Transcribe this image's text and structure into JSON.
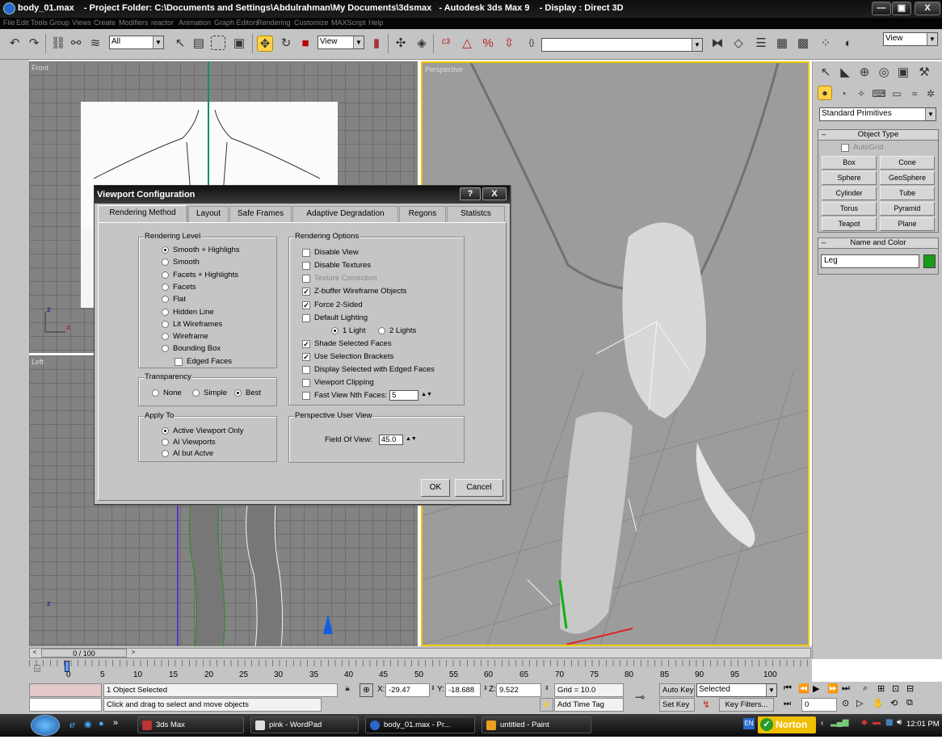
{
  "window": {
    "title": "body_01.max    - Project Folder: C:\\Documents and Settings\\Abdulrahman\\My Documents\\3dsmax   - Autodesk 3ds Max 9    - Display : Direct 3D",
    "minimize": "—",
    "maximize": "▣",
    "close": "X"
  },
  "menu": [
    "File",
    "Edit",
    "Tools",
    "Group",
    "Views",
    "Create",
    "Modifiers",
    "reactor",
    "Animation",
    "Graph Editors",
    "Rendering",
    "Customize",
    "MAXScript",
    "Help"
  ],
  "toolbar": {
    "selection_filter": "All",
    "ref_coord": "View",
    "named_sel": "",
    "view_right": "View"
  },
  "viewports": {
    "front": "Front",
    "left": "Left",
    "perspective": "Perspective"
  },
  "command_panel": {
    "category": "Standard Primitives",
    "object_type_title": "Object Type",
    "autogrid": "AutoGrid",
    "buttons": [
      "Box",
      "Cone",
      "Sphere",
      "GeoSphere",
      "Cylinder",
      "Tube",
      "Torus",
      "Pyramid",
      "Teapot",
      "Plane"
    ],
    "name_color_title": "Name and Color",
    "object_name": "Leg",
    "object_color": "#1a9c1a"
  },
  "dialog": {
    "title": "Viewport Configuration",
    "help_btn": "?",
    "close_btn": "X",
    "tabs": [
      "Rendering Method",
      "Layout",
      "Safe Frames",
      "Adaptive Degradation",
      "Regons",
      "Statistcs"
    ],
    "rendering_level": {
      "title": "Rendering Level",
      "options": [
        "Smooth + Highlighs",
        "Smooth",
        "Facets + Highlights",
        "Facets",
        "Flat",
        "Hidden Line",
        "Lit Wireframes",
        "Wireframe",
        "Bounding Box"
      ],
      "selected": 0,
      "edged_faces": "Edged Faces"
    },
    "transparency": {
      "title": "Transparency",
      "options": [
        "None",
        "Simple",
        "Best"
      ],
      "selected": 2
    },
    "apply_to": {
      "title": "Apply To",
      "options": [
        "Active Viewport Only",
        "Al Viewports",
        "Al but Actve"
      ],
      "selected": 0
    },
    "rendering_options": {
      "title": "Rendering Options",
      "items": [
        {
          "label": "Disable View",
          "checked": false,
          "disabled": false
        },
        {
          "label": "Disable Textures",
          "checked": false,
          "disabled": false
        },
        {
          "label": "Texture Correction",
          "checked": false,
          "disabled": true
        },
        {
          "label": "Z-buffer Wireframe Objects",
          "checked": true,
          "disabled": false
        },
        {
          "label": "Force 2-Sided",
          "checked": true,
          "disabled": false
        },
        {
          "label": "Default Lighting",
          "checked": false,
          "disabled": false
        }
      ],
      "light_1": "1 Light",
      "light_2": "2 Lights",
      "items2": [
        {
          "label": "Shade Selected Faces",
          "checked": true
        },
        {
          "label": "Use Selection Brackets",
          "checked": true
        },
        {
          "label": "Display Selected with Edged Faces",
          "checked": false
        },
        {
          "label": "Viewport Clipping",
          "checked": false
        },
        {
          "label": "Fast View Nth Faces:",
          "checked": false
        }
      ],
      "nth_faces": "5"
    },
    "perspective": {
      "title": "Perspective User View",
      "fov_label": "Field Of View:",
      "fov_value": "45.0"
    },
    "ok": "OK",
    "cancel": "Cancel"
  },
  "timeline": {
    "frame": "0 / 100",
    "ticks": [
      "0",
      "5",
      "10",
      "15",
      "20",
      "25",
      "30",
      "35",
      "40",
      "45",
      "50",
      "55",
      "60",
      "65",
      "70",
      "75",
      "80",
      "85",
      "90",
      "95",
      "100"
    ]
  },
  "status": {
    "selected": "1 Object Selected",
    "prompt": "Click and drag to select and move objects",
    "x_label": "X:",
    "x": "-29.47",
    "y_label": "Y:",
    "y": "-18.688",
    "z_label": "Z:",
    "z": "9.522",
    "grid": "Grid = 10.0",
    "add_time_tag": "Add Time Tag",
    "auto_key": "Auto Key",
    "set_key": "Set Key",
    "key_mode": "Selected",
    "key_filters": "Key Filters...",
    "current_frame": "0"
  },
  "taskbar": {
    "tasks": [
      "3ds Max",
      "pink - WordPad",
      "body_01.max   - Pr...",
      "untitled - Paint"
    ],
    "language": "EN",
    "norton": "Norton",
    "clock": "12:01 PM"
  }
}
